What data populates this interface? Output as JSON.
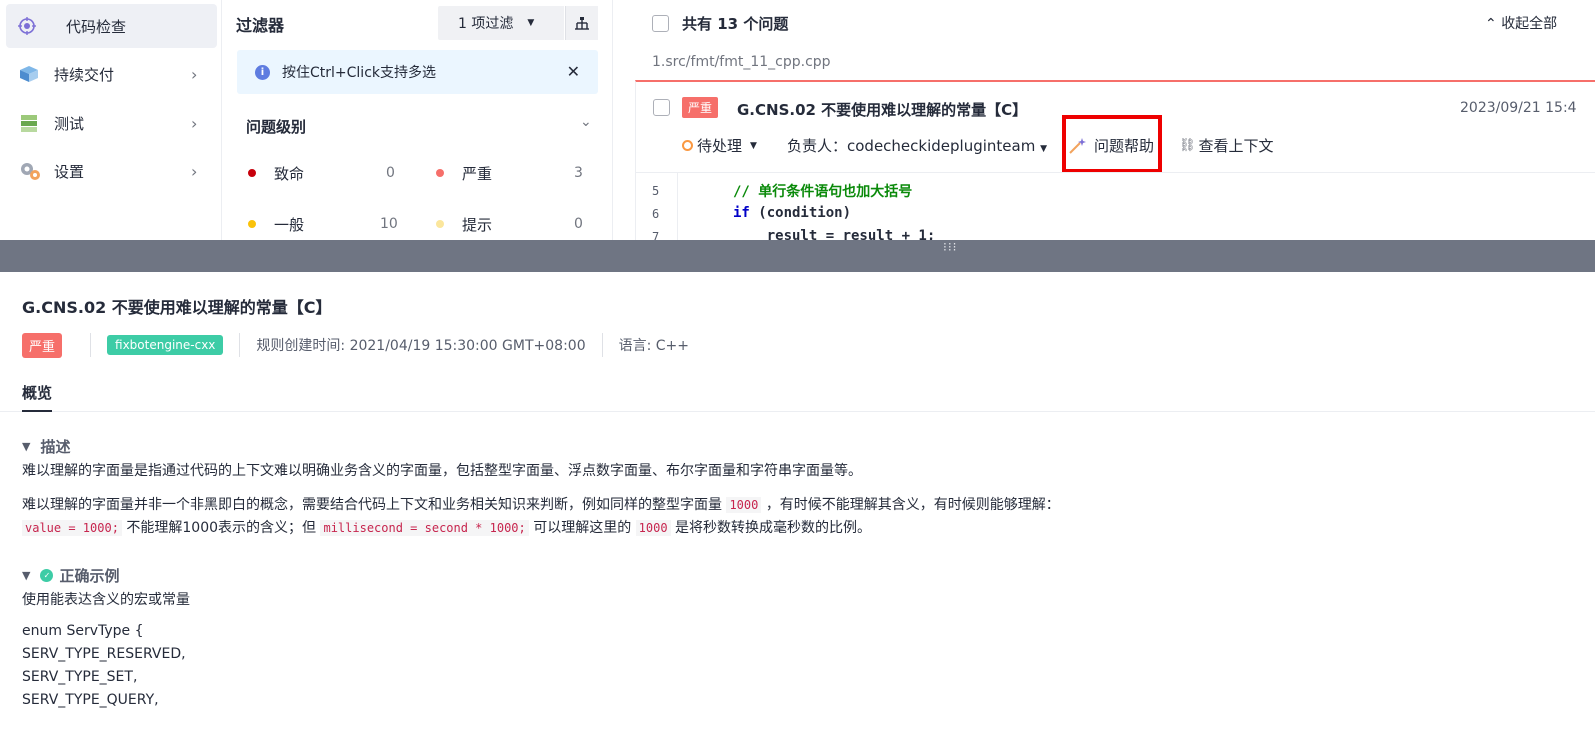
{
  "sidebar": {
    "items": [
      {
        "label": "代码检查",
        "icon": "code-check-icon",
        "active": true
      },
      {
        "label": "持续交付",
        "icon": "delivery-icon"
      },
      {
        "label": "测试",
        "icon": "test-icon"
      },
      {
        "label": "设置",
        "icon": "settings-icon"
      }
    ]
  },
  "filter": {
    "title": "过滤器",
    "select_value": "1 项过滤",
    "info_text": "按住Ctrl+Click支持多选",
    "level_title": "问题级别",
    "levels": [
      {
        "label": "致命",
        "count": "0",
        "color": "#c7000b"
      },
      {
        "label": "严重",
        "count": "3",
        "color": "#f66f6a"
      },
      {
        "label": "一般",
        "count": "10",
        "color": "#fac20a"
      },
      {
        "label": "提示",
        "count": "0",
        "color": "#fbe69c"
      }
    ]
  },
  "issues": {
    "count_label": "共有 13 个问题",
    "collapse_label": "收起全部",
    "file_path": "1.src/fmt/fmt_11_cpp.cpp",
    "card": {
      "severity": "严重",
      "title": "G.CNS.02 不要使用难以理解的常量【C】",
      "date": "2023/09/21 15:4",
      "status": "待处理",
      "owner": "负责人：codecheckidepluginteam",
      "help": "问题帮助",
      "context": "查看上下文",
      "code": [
        {
          "ln": "5",
          "text": "// 单行条件语句也加大括号"
        },
        {
          "ln": "6",
          "kw": "if",
          "text": " (condition)"
        },
        {
          "ln": "7",
          "text": "    result = result + 1;"
        }
      ]
    }
  },
  "detail": {
    "title": "G.CNS.02 不要使用难以理解的常量【C】",
    "severity": "严重",
    "engine": "fixbotengine-cxx",
    "created": "规则创建时间: 2021/04/19 15:30:00 GMT+08:00",
    "language": "语言: C++",
    "tab": "概览",
    "desc_head": "描述",
    "desc_p1": "难以理解的字面量是指通过代码的上下文难以明确业务含义的字面量，包括整型字面量、浮点数字面量、布尔字面量和字符串字面量等。",
    "desc_p2a": "难以理解的字面量并非一个非黑即白的概念，需要结合代码上下文和业务相关知识来判断，例如同样的整型字面量",
    "desc_p2_code1": "1000",
    "desc_p2b": "，有时候不能理解其含义，有时候则能够理解：",
    "desc_p3_code1": "value = 1000;",
    "desc_p3a": "不能理解1000表示的含义；但",
    "desc_p3_code2": "millisecond = second * 1000;",
    "desc_p3b": "可以理解这里的",
    "desc_p3_code3": "1000",
    "desc_p3c": "是将秒数转换成毫秒数的比例。",
    "good_head": "正确示例",
    "good_intro": "使用能表达含义的宏或常量",
    "good_code": [
      "enum ServType {",
      "SERV_TYPE_RESERVED,",
      "SERV_TYPE_SET,",
      "SERV_TYPE_QUERY,"
    ]
  }
}
